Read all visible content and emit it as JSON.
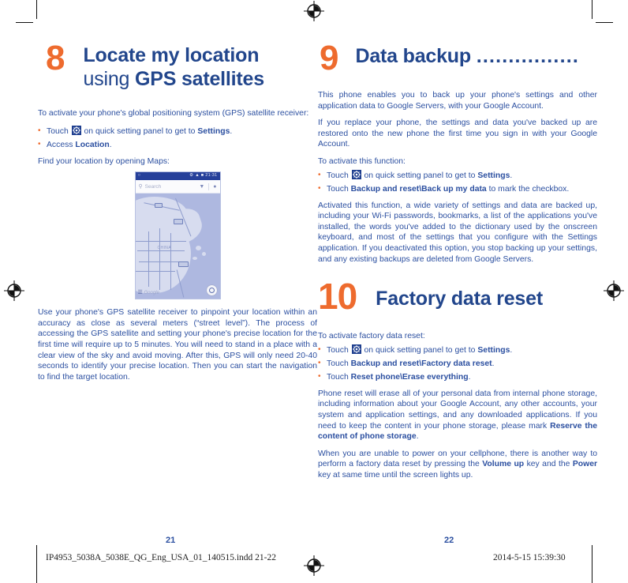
{
  "document": {
    "footer_file": "IP4953_5038A_5038E_QG_Eng_USA_01_140515.indd   21-22",
    "footer_date": "2014-5-15   15:39:30"
  },
  "left_page": {
    "page_number": "21",
    "chapter": {
      "number": "8",
      "title_line1": "Locate my location",
      "title_line2_plain": "using ",
      "title_line2_bold": "GPS satellites"
    },
    "intro": "To activate your phone's global positioning system (GPS) satellite receiver:",
    "bullets": [
      {
        "pre": "Touch ",
        "icon": "settings-gear-icon",
        "mid": " on quick setting panel to get to ",
        "bold": "Settings",
        "post": "."
      },
      {
        "pre": "Access ",
        "bold": "Location",
        "post": "."
      }
    ],
    "find_line": "Find your location by opening Maps:",
    "screenshot": {
      "status_time": "21:31",
      "search_placeholder": "Search",
      "map_label": "CHINA",
      "attribution": "Google"
    },
    "gps_paragraph": "Use your phone's GPS satellite receiver to pinpoint your location within an accuracy as close as several meters (“street level”). The process of accessing the GPS satellite and setting your phone's precise location for the first time will require up to 5 minutes. You will need to stand in a place with a clear view of the sky and avoid moving. After this, GPS will only need 20-40 seconds to identify your precise location. Then you can start the navigation to find the target location."
  },
  "right_page": {
    "page_number": "22",
    "chapter9": {
      "number": "9",
      "title": "Data backup ",
      "leader": "................"
    },
    "para1": "This phone enables you to back up your phone's settings and other application data to Google Servers, with your Google Account.",
    "para2": "If you replace your phone, the settings and data you've backed up are restored onto the new phone the first time you sign in with your Google Account.",
    "activate_line": "To activate this function:",
    "bullets": [
      {
        "pre": "Touch ",
        "icon": "settings-gear-icon",
        "mid": " on quick setting panel to get to ",
        "bold": "Settings",
        "post": "."
      },
      {
        "pre": "Touch ",
        "bold": "Backup and reset\\Back up my data",
        "post": " to mark the checkbox."
      }
    ],
    "para3": "Activated this function, a wide variety of settings and data are backed up, including your Wi-Fi passwords, bookmarks, a list of the applications you've installed, the words you've added to the dictionary used by the onscreen keyboard, and most of the settings that you configure with the Settings application. If you deactivated this option, you stop backing up your settings, and any existing backups are deleted from Google Servers.",
    "chapter10": {
      "number": "10",
      "title": "Factory data reset"
    },
    "activate_line10": "To activate factory data reset:",
    "bullets10": [
      {
        "pre": "Touch ",
        "icon": "settings-gear-icon",
        "mid": " on quick setting panel to get to ",
        "bold": "Settings",
        "post": "."
      },
      {
        "pre": "Touch ",
        "bold": "Backup and reset\\Factory data reset",
        "post": "."
      },
      {
        "pre": "Touch ",
        "bold": "Reset phone\\Erase everything",
        "post": "."
      }
    ],
    "para4_pre": "Phone reset will erase all of your personal data from internal phone storage, including information about your Google Account, any other accounts, your system and application settings, and any downloaded applications. If you need to keep the content in your phone storage, please mark ",
    "para4_bold": "Reserve the content of phone storage",
    "para4_post": ".",
    "para5_pre": "When you are unable to power on your cellphone, there is another way to perform a factory data reset by pressing the ",
    "para5_bold1": "Volume up",
    "para5_mid": " key and the ",
    "para5_bold2": "Power",
    "para5_post": " key at same time until the screen lights up."
  },
  "colors": {
    "heading_blue": "#22468C",
    "body_blue": "#2B4FA0",
    "accent_orange": "#EE6B2E"
  }
}
